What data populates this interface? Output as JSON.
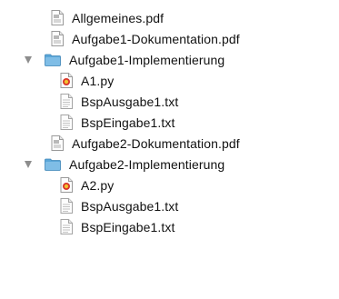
{
  "file_list": {
    "items": [
      {
        "label": "Allgemeines.pdf",
        "kind": "file",
        "icon": "pdf-document-icon",
        "level": 0
      },
      {
        "label": "Aufgabe1-Dokumentation.pdf",
        "kind": "file",
        "icon": "pdf-document-icon",
        "level": 0
      },
      {
        "label": "Aufgabe1-Implementierung",
        "kind": "folder",
        "icon": "folder-icon",
        "level": 0,
        "expanded": true
      },
      {
        "label": "A1.py",
        "kind": "file",
        "icon": "python-script-icon",
        "level": 1
      },
      {
        "label": "BspAusgabe1.txt",
        "kind": "file",
        "icon": "text-document-icon",
        "level": 1
      },
      {
        "label": "BspEingabe1.txt",
        "kind": "file",
        "icon": "text-document-icon",
        "level": 1
      },
      {
        "label": "Aufgabe2-Dokumentation.pdf",
        "kind": "file",
        "icon": "pdf-document-icon",
        "level": 0
      },
      {
        "label": "Aufgabe2-Implementierung",
        "kind": "folder",
        "icon": "folder-icon",
        "level": 0,
        "expanded": true
      },
      {
        "label": "A2.py",
        "kind": "file",
        "icon": "python-script-icon",
        "level": 1
      },
      {
        "label": "BspAusgabe1.txt",
        "kind": "file",
        "icon": "text-document-icon",
        "level": 1
      },
      {
        "label": "BspEingabe1.txt",
        "kind": "file",
        "icon": "text-document-icon",
        "level": 1
      }
    ]
  },
  "colors": {
    "folder": "#5aa6d8",
    "disclosure": "#8d8d8d",
    "python_red": "#d9342b",
    "python_yellow": "#f2c12e"
  }
}
